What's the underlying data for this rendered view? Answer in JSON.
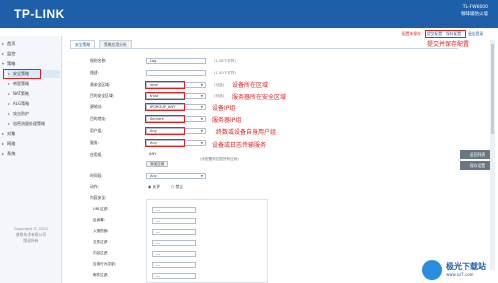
{
  "header": {
    "logo": "TP-LINK",
    "model": "TL-FW6600",
    "product": "咖啡级防火墙"
  },
  "toplinks": {
    "save": "配置未保存",
    "commit": "提交配置",
    "save_cfg": "保存配置",
    "exit": "退出登录"
  },
  "sidebar": {
    "items": [
      {
        "label": "首页"
      },
      {
        "label": "监控"
      },
      {
        "label": "策略"
      },
      {
        "label": "对象"
      },
      {
        "label": "网络"
      },
      {
        "label": "系统"
      }
    ],
    "sub_items": [
      {
        "label": "安全策略"
      },
      {
        "label": "带宽策略"
      },
      {
        "label": "NAT策略"
      },
      {
        "label": "ALG策略"
      },
      {
        "label": "攻击防护"
      },
      {
        "label": "加密流量处理策略"
      }
    ],
    "copyright": [
      "Copyright © 2021",
      "普联技术有限公司",
      "版权所有"
    ]
  },
  "tabs": [
    {
      "label": "安全策略"
    },
    {
      "label": "策略应用分析"
    }
  ],
  "form": {
    "name_label": "规则名称:",
    "name_value": "Log",
    "name_hint": "(1-28个字符)",
    "desc_label": "描述:",
    "desc_hint": "(1-50个字符)",
    "src_zone_label": "源安全区域:",
    "src_zone_value": "local",
    "src_zone_hint": "(可选)",
    "dst_zone_label": "目的安全区域:",
    "dst_zone_value": "trust",
    "dst_zone_hint": "(可选)",
    "src_addr_label": "源地址:",
    "src_addr_value": "IPGROUP_ANY",
    "dst_addr_label": "目的地址:",
    "dst_addr_value": "Servers",
    "user_label": "用户组:",
    "user_value": "Any",
    "service_label": "服务:",
    "service_value": "Any",
    "app_label": "应用组:",
    "app_value": "ANY",
    "app_hint": "(未配置则匹配所有应用)",
    "app_button": "添加应用",
    "time_label": "时间段:",
    "time_value": "Any",
    "action_label": "动作:",
    "allow": "允许",
    "deny": "禁止",
    "content_label": "内容安全:",
    "url_label": "URL过滤:",
    "url_value": "---",
    "av_label": "反病毒:",
    "av_value": "---",
    "ips_label": "入侵防御:",
    "ips_value": "---",
    "file_label": "文件过滤:",
    "file_value": "---",
    "cf_label": "内容过滤:",
    "cf_value": "---",
    "behav_label": "应用行为控制:",
    "behav_value": "---",
    "mail_label": "邮件过滤:",
    "mail_value": "---"
  },
  "annotations": {
    "commit": "提交并保存配置",
    "zone": "设备所在区域",
    "dst_zone": "服务器所在安全区域",
    "src_addr": "设备IP组",
    "dst_addr": "服务器IP组",
    "user": "终数或设备自身用户组",
    "service": "设备或日志传输服务"
  },
  "right_buttons": {
    "back": "返回列表",
    "save": "保存设置"
  },
  "watermark": {
    "title": "极光下载站",
    "url": "www.xz7.com"
  },
  "colors": {
    "brand": "#1d5fa8",
    "annotation": "#e02020"
  }
}
